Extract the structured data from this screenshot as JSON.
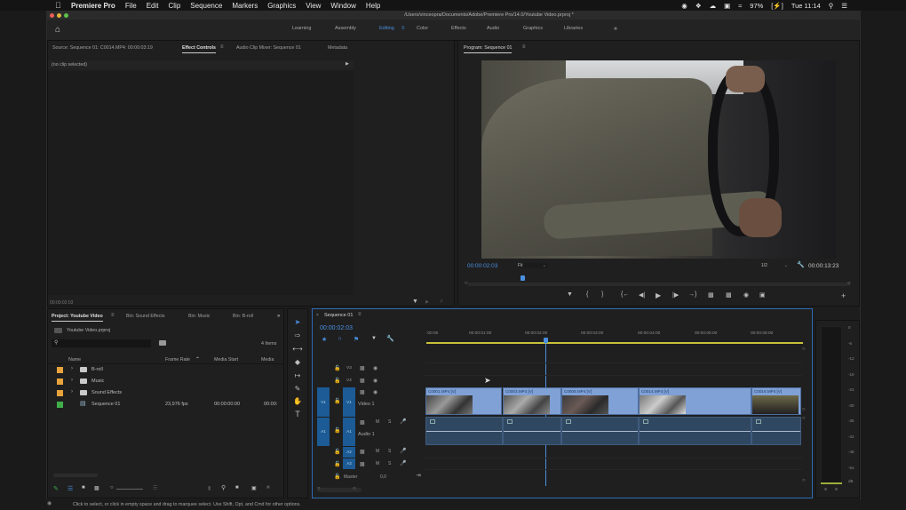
{
  "menubar": {
    "apple": "",
    "app_name": "Premiere Pro",
    "items": [
      "File",
      "Edit",
      "Clip",
      "Sequence",
      "Markers",
      "Graphics",
      "View",
      "Window",
      "Help"
    ],
    "battery": "97%",
    "clock": "Tue 11:14"
  },
  "window": {
    "title": "/Users/vinceopra/Documents/Adobe/Premiere Pro/14.0/Youtube Video.prproj *"
  },
  "workspaces": {
    "tabs": [
      "Learning",
      "Assembly",
      "Editing",
      "Color",
      "Effects",
      "Audio",
      "Graphics",
      "Libraries"
    ],
    "active": "Editing",
    "overflow": "»"
  },
  "source_panel": {
    "tabs": [
      "Source: Sequence 01: C0014.MP4: 00:00:03:19",
      "Effect Controls",
      "Audio Clip Mixer: Sequence 01",
      "Metadata"
    ],
    "active_tab": "Effect Controls",
    "no_clip": "(no clip selected)",
    "timecode": "00:00:02:03"
  },
  "program_monitor": {
    "title": "Program: Sequence 01",
    "timecode": "00:00:02:03",
    "zoom": "Fit",
    "resolution": "1/2",
    "duration": "00:00:13:23"
  },
  "project_panel": {
    "tabs": [
      "Project: Youtube Video",
      "Bin: Sound Effects",
      "Bin: Music",
      "Bin: B-roll"
    ],
    "active_tab": "Project: Youtube Video",
    "overflow": "»",
    "project_file": "Youtube Video.prproj",
    "search_placeholder": "",
    "item_count": "4 Items",
    "columns": [
      "Name",
      "Frame Rate",
      "Media Start",
      "Media"
    ],
    "items": [
      {
        "name": "B-roll",
        "type": "bin",
        "color": "#e8a33c",
        "frame_rate": "",
        "media_start": "",
        "media": ""
      },
      {
        "name": "Music",
        "type": "bin",
        "color": "#e8a33c",
        "frame_rate": "",
        "media_start": "",
        "media": ""
      },
      {
        "name": "Sound Effects",
        "type": "bin",
        "color": "#e8a33c",
        "frame_rate": "",
        "media_start": "",
        "media": ""
      },
      {
        "name": "Sequence 01",
        "type": "sequence",
        "color": "#3fae49",
        "frame_rate": "23,976 fps",
        "media_start": "00:00:00:00",
        "media": "00:00:"
      }
    ]
  },
  "timeline": {
    "sequence_name": "Sequence 01",
    "timecode": "00:00:02:03",
    "ruler": [
      ":00:00",
      "00:00:01:00",
      "00:00:02:00",
      "00:00:03:00",
      "00:00:04:00",
      "00:00:05:00",
      "00:00:06:00"
    ],
    "video_tracks": [
      "V3",
      "V2",
      "V1"
    ],
    "video_track_name": "Video 1",
    "audio_tracks": [
      "A1",
      "A2",
      "A3"
    ],
    "audio_track_name": "Audio 1",
    "master_label": "Master",
    "master_value": "0,0",
    "mute": "M",
    "solo": "S",
    "clips": [
      {
        "label": "C0001.MP4 [V]"
      },
      {
        "label": "C0003.MP4 [V]"
      },
      {
        "label": "C0008.MP4 [V]"
      },
      {
        "label": "C0014.MP4 [V]"
      },
      {
        "label": "C0016.MP4 [V]"
      }
    ]
  },
  "audio_meter": {
    "scale": [
      "0",
      "-6",
      "-12",
      "-18",
      "-24",
      "-30",
      "-36",
      "-42",
      "-48",
      "-54",
      "dB"
    ],
    "channels": [
      "S",
      "S"
    ]
  },
  "status_bar": {
    "text": "Click to select, or click in empty space and drag to marquee select. Use Shift, Opt, and Cmd for other options."
  },
  "colors": {
    "accent": "#4a8fe0",
    "clip_video": "#7fa1d6",
    "clip_audio": "#304761",
    "work_area": "#c8c23a",
    "bin_label": "#e8a33c",
    "sequence_label": "#3fae49"
  }
}
